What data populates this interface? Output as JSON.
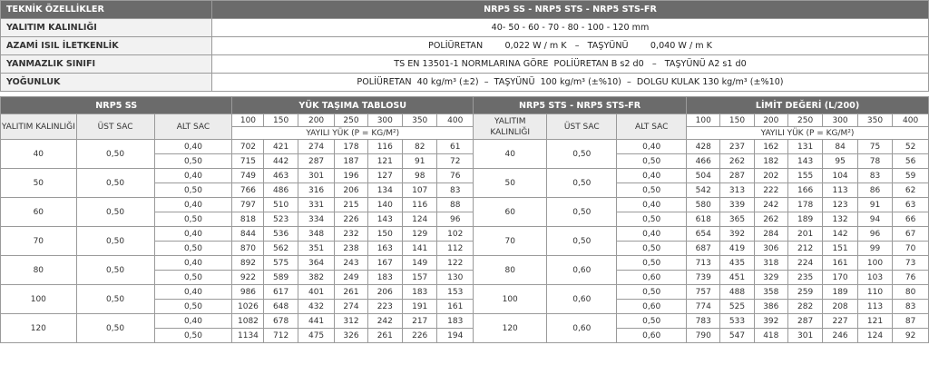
{
  "spec": {
    "header": {
      "label": "TEKNİK ÖZELLİKLER",
      "value": "NRP5 SS - NRP5 STS - NRP5 STS-FR"
    },
    "rows": [
      {
        "label": "YALITIM KALINLIĞI",
        "value": "40- 50 - 60 - 70 - 80 - 100 - 120 mm"
      },
      {
        "label": "AZAMİ ISIL İLETKENLİK",
        "value": "POLİÜRETAN        0,022 W / m K   –   TAŞYÜNÜ        0,040 W / m K"
      },
      {
        "label": "YANMAZLIK SINIFI",
        "value": "TS EN 13501-1 NORMLARINA GÖRE  POLİÜRETAN B s2 d0   –   TAŞYÜNÜ A2 s1 d0"
      },
      {
        "label": "YOĞUNLUK",
        "value": "POLİÜRETAN  40 kg/m³ (±2)  –  TAŞYÜNÜ  100 kg/m³ (±%10)  –  DOLGU KULAK 130 kg/m³ (±%10)"
      }
    ]
  },
  "load": {
    "left_title": "NRP5 SS",
    "left_table_title": "YÜK TAŞIMA TABLOSU",
    "right_title": "NRP5 STS - NRP5 STS-FR",
    "right_table_title": "LİMİT DEĞERİ (L/200)",
    "col_thickness": "YALITIM KALINLIĞI",
    "col_top": "ÜST SAC",
    "col_bottom": "ALT SAC",
    "spans": [
      "100",
      "150",
      "200",
      "250",
      "300",
      "350",
      "400"
    ],
    "unit_label": "YAYILI YÜK (P = KG/M²)",
    "left_groups": [
      {
        "thk": "40",
        "top": "0,50",
        "rows": [
          {
            "alt": "0,40",
            "v": [
              "702",
              "421",
              "274",
              "178",
              "116",
              "82",
              "61"
            ]
          },
          {
            "alt": "0,50",
            "v": [
              "715",
              "442",
              "287",
              "187",
              "121",
              "91",
              "72"
            ]
          }
        ]
      },
      {
        "thk": "50",
        "top": "0,50",
        "rows": [
          {
            "alt": "0,40",
            "v": [
              "749",
              "463",
              "301",
              "196",
              "127",
              "98",
              "76"
            ]
          },
          {
            "alt": "0,50",
            "v": [
              "766",
              "486",
              "316",
              "206",
              "134",
              "107",
              "83"
            ]
          }
        ]
      },
      {
        "thk": "60",
        "top": "0,50",
        "rows": [
          {
            "alt": "0,40",
            "v": [
              "797",
              "510",
              "331",
              "215",
              "140",
              "116",
              "88"
            ]
          },
          {
            "alt": "0,50",
            "v": [
              "818",
              "523",
              "334",
              "226",
              "143",
              "124",
              "96"
            ]
          }
        ]
      },
      {
        "thk": "70",
        "top": "0,50",
        "rows": [
          {
            "alt": "0,40",
            "v": [
              "844",
              "536",
              "348",
              "232",
              "150",
              "129",
              "102"
            ]
          },
          {
            "alt": "0,50",
            "v": [
              "870",
              "562",
              "351",
              "238",
              "163",
              "141",
              "112"
            ]
          }
        ]
      },
      {
        "thk": "80",
        "top": "0,50",
        "rows": [
          {
            "alt": "0,40",
            "v": [
              "892",
              "575",
              "364",
              "243",
              "167",
              "149",
              "122"
            ]
          },
          {
            "alt": "0,50",
            "v": [
              "922",
              "589",
              "382",
              "249",
              "183",
              "157",
              "130"
            ]
          }
        ]
      },
      {
        "thk": "100",
        "top": "0,50",
        "rows": [
          {
            "alt": "0,40",
            "v": [
              "986",
              "617",
              "401",
              "261",
              "206",
              "183",
              "153"
            ]
          },
          {
            "alt": "0,50",
            "v": [
              "1026",
              "648",
              "432",
              "274",
              "223",
              "191",
              "161"
            ]
          }
        ]
      },
      {
        "thk": "120",
        "top": "0,50",
        "rows": [
          {
            "alt": "0,40",
            "v": [
              "1082",
              "678",
              "441",
              "312",
              "242",
              "217",
              "183"
            ]
          },
          {
            "alt": "0,50",
            "v": [
              "1134",
              "712",
              "475",
              "326",
              "261",
              "226",
              "194"
            ]
          }
        ]
      }
    ],
    "right_groups": [
      {
        "thk": "40",
        "top": "0,50",
        "rows": [
          {
            "alt": "0,40",
            "v": [
              "428",
              "237",
              "162",
              "131",
              "84",
              "75",
              "52"
            ]
          },
          {
            "alt": "0,50",
            "v": [
              "466",
              "262",
              "182",
              "143",
              "95",
              "78",
              "56"
            ]
          }
        ]
      },
      {
        "thk": "50",
        "top": "0,50",
        "rows": [
          {
            "alt": "0,40",
            "v": [
              "504",
              "287",
              "202",
              "155",
              "104",
              "83",
              "59"
            ]
          },
          {
            "alt": "0,50",
            "v": [
              "542",
              "313",
              "222",
              "166",
              "113",
              "86",
              "62"
            ]
          }
        ]
      },
      {
        "thk": "60",
        "top": "0,50",
        "rows": [
          {
            "alt": "0,40",
            "v": [
              "580",
              "339",
              "242",
              "178",
              "123",
              "91",
              "63"
            ]
          },
          {
            "alt": "0,50",
            "v": [
              "618",
              "365",
              "262",
              "189",
              "132",
              "94",
              "66"
            ]
          }
        ]
      },
      {
        "thk": "70",
        "top": "0,50",
        "rows": [
          {
            "alt": "0,40",
            "v": [
              "654",
              "392",
              "284",
              "201",
              "142",
              "96",
              "67"
            ]
          },
          {
            "alt": "0,50",
            "v": [
              "687",
              "419",
              "306",
              "212",
              "151",
              "99",
              "70"
            ]
          }
        ]
      },
      {
        "thk": "80",
        "top": "0,60",
        "rows": [
          {
            "alt": "0,50",
            "v": [
              "713",
              "435",
              "318",
              "224",
              "161",
              "100",
              "73"
            ]
          },
          {
            "alt": "0,60",
            "v": [
              "739",
              "451",
              "329",
              "235",
              "170",
              "103",
              "76"
            ]
          }
        ]
      },
      {
        "thk": "100",
        "top": "0,60",
        "rows": [
          {
            "alt": "0,50",
            "v": [
              "757",
              "488",
              "358",
              "259",
              "189",
              "110",
              "80"
            ]
          },
          {
            "alt": "0,60",
            "v": [
              "774",
              "525",
              "386",
              "282",
              "208",
              "113",
              "83"
            ]
          }
        ]
      },
      {
        "thk": "120",
        "top": "0,60",
        "rows": [
          {
            "alt": "0,50",
            "v": [
              "783",
              "533",
              "392",
              "287",
              "227",
              "121",
              "87"
            ]
          },
          {
            "alt": "0,60",
            "v": [
              "790",
              "547",
              "418",
              "301",
              "246",
              "124",
              "92"
            ]
          }
        ]
      }
    ]
  }
}
